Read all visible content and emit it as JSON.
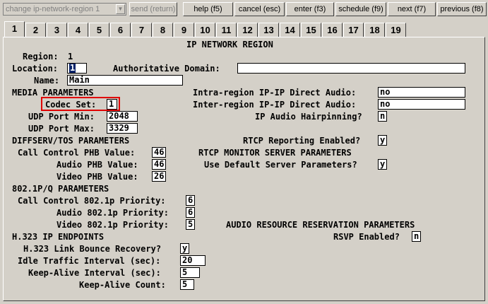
{
  "toolbar": {
    "command": "change ip-network-region 1",
    "send": "send (return)",
    "help": "help (f5)",
    "cancel": "cancel (esc)",
    "enter": "enter (f3)",
    "schedule": "schedule (f9)",
    "next": "next (f7)",
    "previous": "previous (f8)"
  },
  "tabs": [
    "1",
    "2",
    "3",
    "4",
    "5",
    "6",
    "7",
    "8",
    "9",
    "10",
    "11",
    "12",
    "13",
    "14",
    "15",
    "16",
    "17",
    "18",
    "19"
  ],
  "form": {
    "title": "IP NETWORK REGION",
    "region_label": "Region:",
    "region_value": "1",
    "location_label": "Location:",
    "location_value": "1",
    "auth_domain_label": "Authoritative Domain:",
    "auth_domain_value": "",
    "name_label": "Name:",
    "name_value": "Main",
    "media_params": "MEDIA PARAMETERS",
    "codec_set_label": "Codec Set:",
    "codec_set_value": "1",
    "udp_min_label": "UDP Port Min:",
    "udp_min_value": "2048",
    "udp_max_label": "UDP Port Max:",
    "udp_max_value": "3329",
    "intra_label": "Intra-region IP-IP Direct Audio:",
    "intra_value": "no",
    "inter_label": "Inter-region IP-IP Direct Audio:",
    "inter_value": "no",
    "hairpin_label": "IP Audio Hairpinning?",
    "hairpin_value": "n",
    "diffserv": "DIFFSERV/TOS PARAMETERS",
    "cc_phb_label": "Call Control PHB Value:",
    "cc_phb_value": "46",
    "audio_phb_label": "Audio PHB Value:",
    "audio_phb_value": "46",
    "video_phb_label": "Video PHB Value:",
    "video_phb_value": "26",
    "rtcp_label": "RTCP Reporting Enabled?",
    "rtcp_value": "y",
    "rtcp_monitor": "RTCP MONITOR SERVER PARAMETERS",
    "use_default_label": "Use Default Server Parameters?",
    "use_default_value": "y",
    "dot1pq": "802.1P/Q PARAMETERS",
    "cc_8021p_label": "Call Control 802.1p Priority:",
    "cc_8021p_value": "6",
    "audio_8021p_label": "Audio 802.1p Priority:",
    "audio_8021p_value": "6",
    "video_8021p_label": "Video 802.1p Priority:",
    "video_8021p_value": "5",
    "audio_resv": "AUDIO RESOURCE RESERVATION PARAMETERS",
    "rsvp_label": "RSVP Enabled?",
    "rsvp_value": "n",
    "h323": "H.323 IP ENDPOINTS",
    "link_bounce_label": "H.323 Link Bounce Recovery?",
    "link_bounce_value": "y",
    "idle_label": "Idle Traffic Interval (sec):",
    "idle_value": "20",
    "keepalive_int_label": "Keep-Alive Interval (sec):",
    "keepalive_int_value": "5",
    "keepalive_count_label": "Keep-Alive Count:",
    "keepalive_count_value": "5"
  },
  "colors": {
    "highlight_box": "#e00000",
    "selection": "#0a246a",
    "background": "#d4d0c8"
  }
}
